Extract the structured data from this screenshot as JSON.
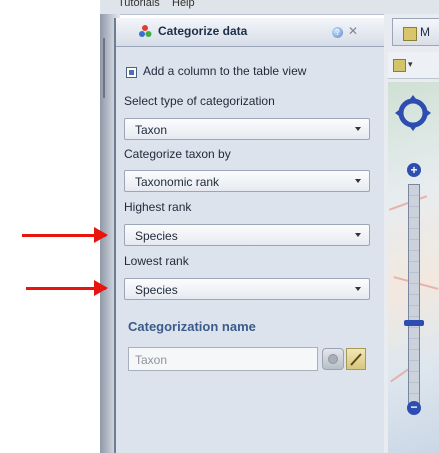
{
  "menubar": {
    "items": [
      "Tutorials",
      "Help"
    ]
  },
  "panel": {
    "title": "Categorize data",
    "help_icon": "help-icon",
    "close_icon": "close-icon",
    "add_column_checkbox_label": "Add a column to the table view",
    "add_column_checked": true,
    "categorization_type": {
      "label": "Select type of categorization",
      "value": "Taxon"
    },
    "categorize_by": {
      "label": "Categorize taxon by",
      "value": "Taxonomic rank"
    },
    "highest_rank": {
      "label": "Highest rank",
      "value": "Species"
    },
    "lowest_rank": {
      "label": "Lowest rank",
      "value": "Species"
    },
    "categorization_name": {
      "title": "Categorization name",
      "value": "Taxon"
    }
  },
  "right": {
    "tab_label": "M",
    "toolbar_icon": "map-layer-icon"
  },
  "colors": {
    "arrow": "#e8150f",
    "panel_bg": "#dde3ec",
    "title": "#3b5b8c"
  }
}
